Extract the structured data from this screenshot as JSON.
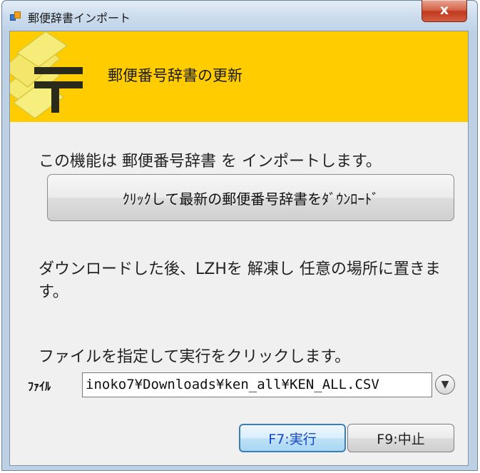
{
  "window": {
    "title": "郵便辞書インポート",
    "close_label": "x"
  },
  "banner": {
    "title": "郵便番号辞書の更新",
    "logo_icon": "postal-mark-icon"
  },
  "content": {
    "description": "この機能は 郵便番号辞書 を インポートします。",
    "download_button_label": "ｸﾘｯｸして最新の郵便番号辞書をﾀﾞｳﾝﾛｰﾄﾞ",
    "after_download_text": "ダウンロードした後、LZHを 解凍し 任意の場所に置きます。",
    "instruction_text": "ファイルを指定して実行をクリックします。"
  },
  "file": {
    "label": "ﾌｧｲﾙ",
    "value": "inoko7¥Downloads¥ken_all¥KEN_ALL.CSV",
    "dropdown_icon": "chevron-down-icon"
  },
  "buttons": {
    "execute_label": "F7:実行",
    "cancel_label": "F9:中止"
  },
  "colors": {
    "banner_bg": "#ffcc00",
    "window_frame": "#bdd0e4",
    "execute_text": "#1446c8",
    "close_button": "#c0391f"
  }
}
